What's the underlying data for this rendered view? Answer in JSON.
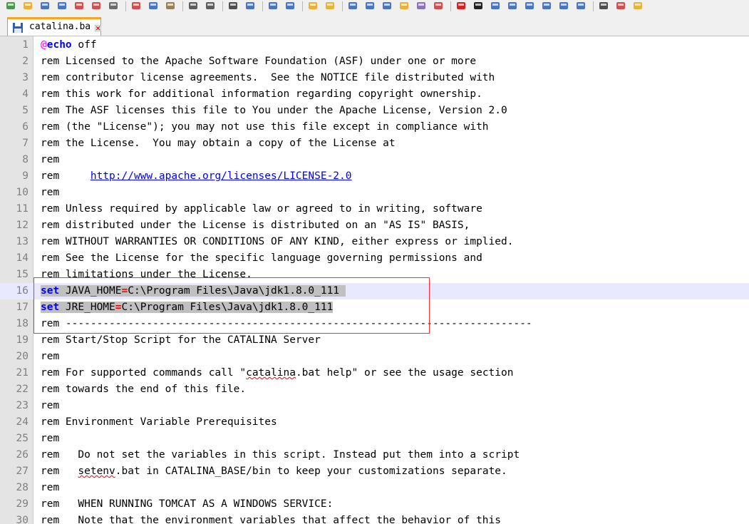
{
  "toolbar": {
    "buttons": [
      {
        "name": "new-file-icon",
        "color": "#2e8b2e"
      },
      {
        "name": "open-folder-icon",
        "color": "#e6a817"
      },
      {
        "name": "save-icon",
        "color": "#2b5fb8"
      },
      {
        "name": "save-all-icon",
        "color": "#2b5fb8"
      },
      {
        "name": "close-icon",
        "color": "#cc3333"
      },
      {
        "name": "close-all-icon",
        "color": "#cc3333"
      },
      {
        "name": "print-icon",
        "color": "#555555"
      },
      {
        "name": "cut-icon",
        "color": "#cc3333"
      },
      {
        "name": "copy-icon",
        "color": "#2b5fb8"
      },
      {
        "name": "paste-icon",
        "color": "#8a6d3b"
      },
      {
        "name": "undo-icon",
        "color": "#444444"
      },
      {
        "name": "redo-icon",
        "color": "#444444"
      },
      {
        "name": "find-icon",
        "color": "#333333"
      },
      {
        "name": "replace-icon",
        "color": "#2b5fb8"
      },
      {
        "name": "zoom-in-icon",
        "color": "#2b5fb8"
      },
      {
        "name": "zoom-out-icon",
        "color": "#2b5fb8"
      },
      {
        "name": "sync-vertical-icon",
        "color": "#e6a817"
      },
      {
        "name": "sync-horizontal-icon",
        "color": "#e6a817"
      },
      {
        "name": "word-wrap-icon",
        "color": "#2b5fb8"
      },
      {
        "name": "show-all-chars-icon",
        "color": "#2b5fb8"
      },
      {
        "name": "indent-guide-icon",
        "color": "#2b5fb8"
      },
      {
        "name": "user-language-icon",
        "color": "#e6a817"
      },
      {
        "name": "doc-map-icon",
        "color": "#7a5cb8"
      },
      {
        "name": "function-list-icon",
        "color": "#cc3333"
      },
      {
        "name": "record-macro-icon",
        "color": "#cc0000"
      },
      {
        "name": "stop-macro-icon",
        "color": "#000000"
      },
      {
        "name": "play-macro-icon",
        "color": "#2b5fb8"
      },
      {
        "name": "run-macro-multiple-icon",
        "color": "#2b5fb8"
      },
      {
        "name": "save-macro-icon",
        "color": "#2b5fb8"
      },
      {
        "name": "eject-icon",
        "color": "#2b5fb8"
      },
      {
        "name": "prev-icon",
        "color": "#2b5fb8"
      },
      {
        "name": "next-icon",
        "color": "#2b5fb8"
      },
      {
        "name": "editor-icon",
        "color": "#333333"
      },
      {
        "name": "spell-check-icon",
        "color": "#cc3333"
      },
      {
        "name": "search-icon",
        "color": "#e6a817"
      }
    ]
  },
  "tab": {
    "label": "catalina.ba",
    "icon": "save-icon",
    "close_icon": "close-icon"
  },
  "editor": {
    "current_line": 16,
    "lines": [
      {
        "n": "1",
        "text": "@echo off"
      },
      {
        "n": "2",
        "text": "rem Licensed to the Apache Software Foundation (ASF) under one or more"
      },
      {
        "n": "3",
        "text": "rem contributor license agreements.  See the NOTICE file distributed with"
      },
      {
        "n": "4",
        "text": "rem this work for additional information regarding copyright ownership."
      },
      {
        "n": "5",
        "text": "rem The ASF licenses this file to You under the Apache License, Version 2.0"
      },
      {
        "n": "6",
        "text": "rem (the \"License\"); you may not use this file except in compliance with"
      },
      {
        "n": "7",
        "text": "rem the License.  You may obtain a copy of the License at"
      },
      {
        "n": "8",
        "text": "rem"
      },
      {
        "n": "9",
        "text": "rem     http://www.apache.org/licenses/LICENSE-2.0"
      },
      {
        "n": "10",
        "text": "rem"
      },
      {
        "n": "11",
        "text": "rem Unless required by applicable law or agreed to in writing, software"
      },
      {
        "n": "12",
        "text": "rem distributed under the License is distributed on an \"AS IS\" BASIS,"
      },
      {
        "n": "13",
        "text": "rem WITHOUT WARRANTIES OR CONDITIONS OF ANY KIND, either express or implied."
      },
      {
        "n": "14",
        "text": "rem See the License for the specific language governing permissions and"
      },
      {
        "n": "15",
        "text": "rem limitations under the License."
      },
      {
        "n": "16",
        "text": "set JAVA_HOME=C:\\Program Files\\Java\\jdk1.8.0_111 "
      },
      {
        "n": "17",
        "text": "set JRE_HOME=C:\\Program Files\\Java\\jdk1.8.0_111"
      },
      {
        "n": "18",
        "text": "rem ---------------------------------------------------------------------------"
      },
      {
        "n": "19",
        "text": "rem Start/Stop Script for the CATALINA Server"
      },
      {
        "n": "20",
        "text": "rem"
      },
      {
        "n": "21",
        "text": "rem For supported commands call \"catalina.bat help\" or see the usage section"
      },
      {
        "n": "22",
        "text": "rem towards the end of this file."
      },
      {
        "n": "23",
        "text": "rem"
      },
      {
        "n": "24",
        "text": "rem Environment Variable Prerequisites"
      },
      {
        "n": "25",
        "text": "rem"
      },
      {
        "n": "26",
        "text": "rem   Do not set the variables in this script. Instead put them into a script"
      },
      {
        "n": "27",
        "text": "rem   setenv.bat in CATALINA_BASE/bin to keep your customizations separate."
      },
      {
        "n": "28",
        "text": "rem"
      },
      {
        "n": "29",
        "text": "rem   WHEN RUNNING TOMCAT AS A WINDOWS SERVICE:"
      },
      {
        "n": "30",
        "text": "rem   Note that the environment variables that affect the behavior of this"
      }
    ]
  }
}
